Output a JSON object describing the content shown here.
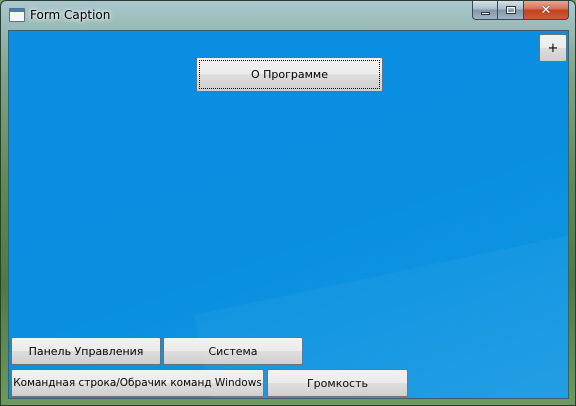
{
  "window": {
    "title": "Form Caption",
    "controls": {
      "minimize": "minimize",
      "maximize": "maximize",
      "close": "✕"
    }
  },
  "client": {
    "about_button": "О Программе",
    "plus_button": "+",
    "control_panel_button": "Панель Управления",
    "system_button": "Система",
    "command_prompt_button": "Командная строка/Обрачик команд Windows",
    "volume_button": "Громкость"
  },
  "colors": {
    "client_background": "#0b8de2",
    "close_button": "#c2421f"
  }
}
